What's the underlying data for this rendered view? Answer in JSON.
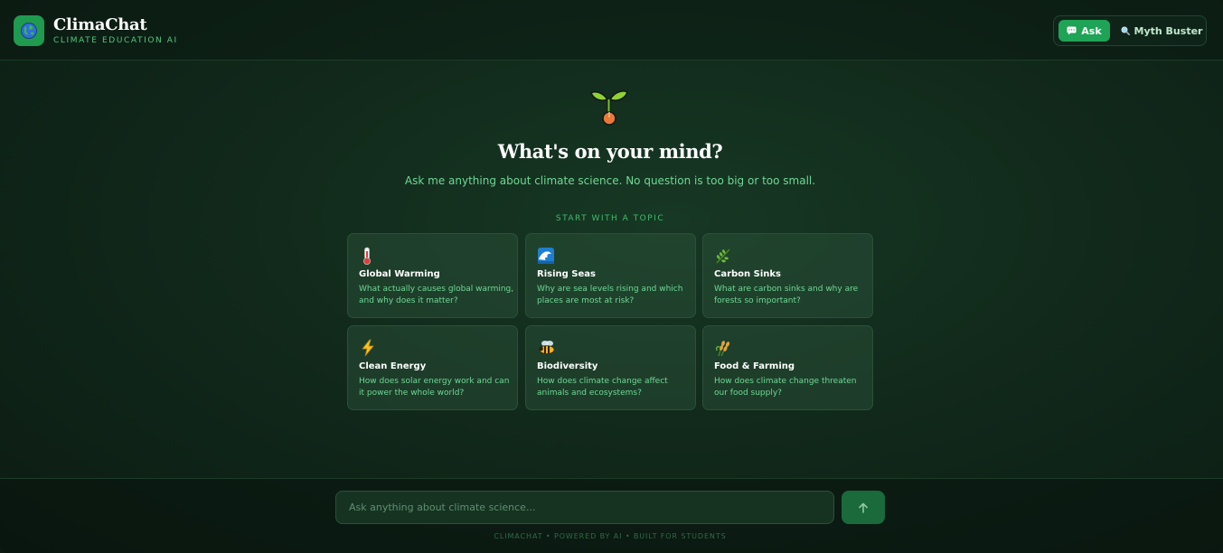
{
  "brand": {
    "title": "ClimaChat",
    "subtitle": "CLIMATE EDUCATION AI",
    "logo_icon": "globe-icon"
  },
  "modes": [
    {
      "label": "Ask",
      "icon": "speech-bubble-icon",
      "active": true
    },
    {
      "label": "Myth Buster",
      "icon": "magnifier-icon",
      "active": false
    }
  ],
  "hero": {
    "icon": "seedling-icon",
    "title": "What's on your mind?",
    "subtitle": "Ask me anything about climate science. No question is too big or too small.",
    "topics_label": "START WITH A TOPIC"
  },
  "topics": [
    {
      "icon": "thermometer-icon",
      "title": "Global Warming",
      "description": "What actually causes global warming, and why does it matter?"
    },
    {
      "icon": "wave-icon",
      "title": "Rising Seas",
      "description": "Why are sea levels rising and which places are most at risk?"
    },
    {
      "icon": "leaf-icon",
      "title": "Carbon Sinks",
      "description": "What are carbon sinks and why are forests so important?"
    },
    {
      "icon": "lightning-icon",
      "title": "Clean Energy",
      "description": "How does solar energy work and can it power the whole world?"
    },
    {
      "icon": "bee-icon",
      "title": "Biodiversity",
      "description": "How does climate change affect animals and ecosystems?"
    },
    {
      "icon": "wheat-icon",
      "title": "Food & Farming",
      "description": "How does climate change threaten our food supply?"
    }
  ],
  "input": {
    "placeholder": "Ask anything about climate science...",
    "value": "",
    "send_icon": "arrow-up-icon"
  },
  "footer": {
    "note": "CLIMACHAT  •  POWERED BY AI  •  BUILT FOR STUDENTS"
  },
  "colors": {
    "accent": "#1fa356",
    "text_green": "#6fd895",
    "background": "#11291b"
  }
}
